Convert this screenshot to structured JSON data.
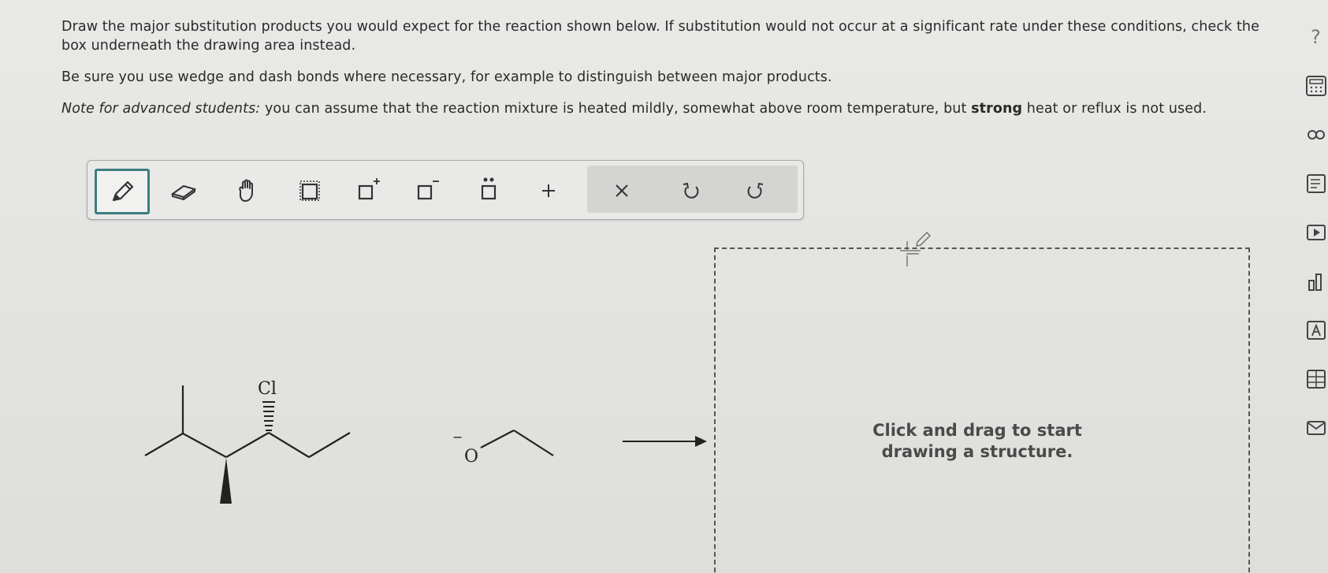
{
  "question": {
    "line1": "Draw the major substitution products you would expect for the reaction shown below. If substitution would not occur at a significant rate under these conditions, check the box underneath the drawing area instead.",
    "line2": "Be sure you use wedge and dash bonds where necessary, for example to distinguish between major products.",
    "note_label": "Note for advanced students:",
    "note_text_a": " you can assume that the reaction mixture is heated mildly, somewhat above room temperature, but ",
    "note_bold": "strong",
    "note_text_b": " heat or reflux is not used."
  },
  "toolbar": {
    "tools": [
      "pencil-icon",
      "eraser-icon",
      "hand-icon",
      "select-box-icon",
      "positive-charge-icon",
      "negative-charge-icon",
      "lone-pair-icon",
      "add-icon",
      "clear-icon",
      "undo-icon",
      "redo-icon"
    ],
    "selected": "pencil-icon",
    "accent_color": "#3d7d80"
  },
  "reaction": {
    "reactant_atom_label": "Cl",
    "reagent_atom_label": "O",
    "reagent_charge": "−"
  },
  "drawing_area": {
    "hint_line1": "Click and drag to start",
    "hint_line2": "drawing a structure."
  },
  "sidebar": {
    "help_label": "?",
    "icons": [
      "help-icon",
      "calculator-icon",
      "link-icon",
      "textbook-icon",
      "video-icon",
      "chart-icon",
      "reference-icon",
      "periodic-table-icon",
      "mail-icon"
    ]
  }
}
